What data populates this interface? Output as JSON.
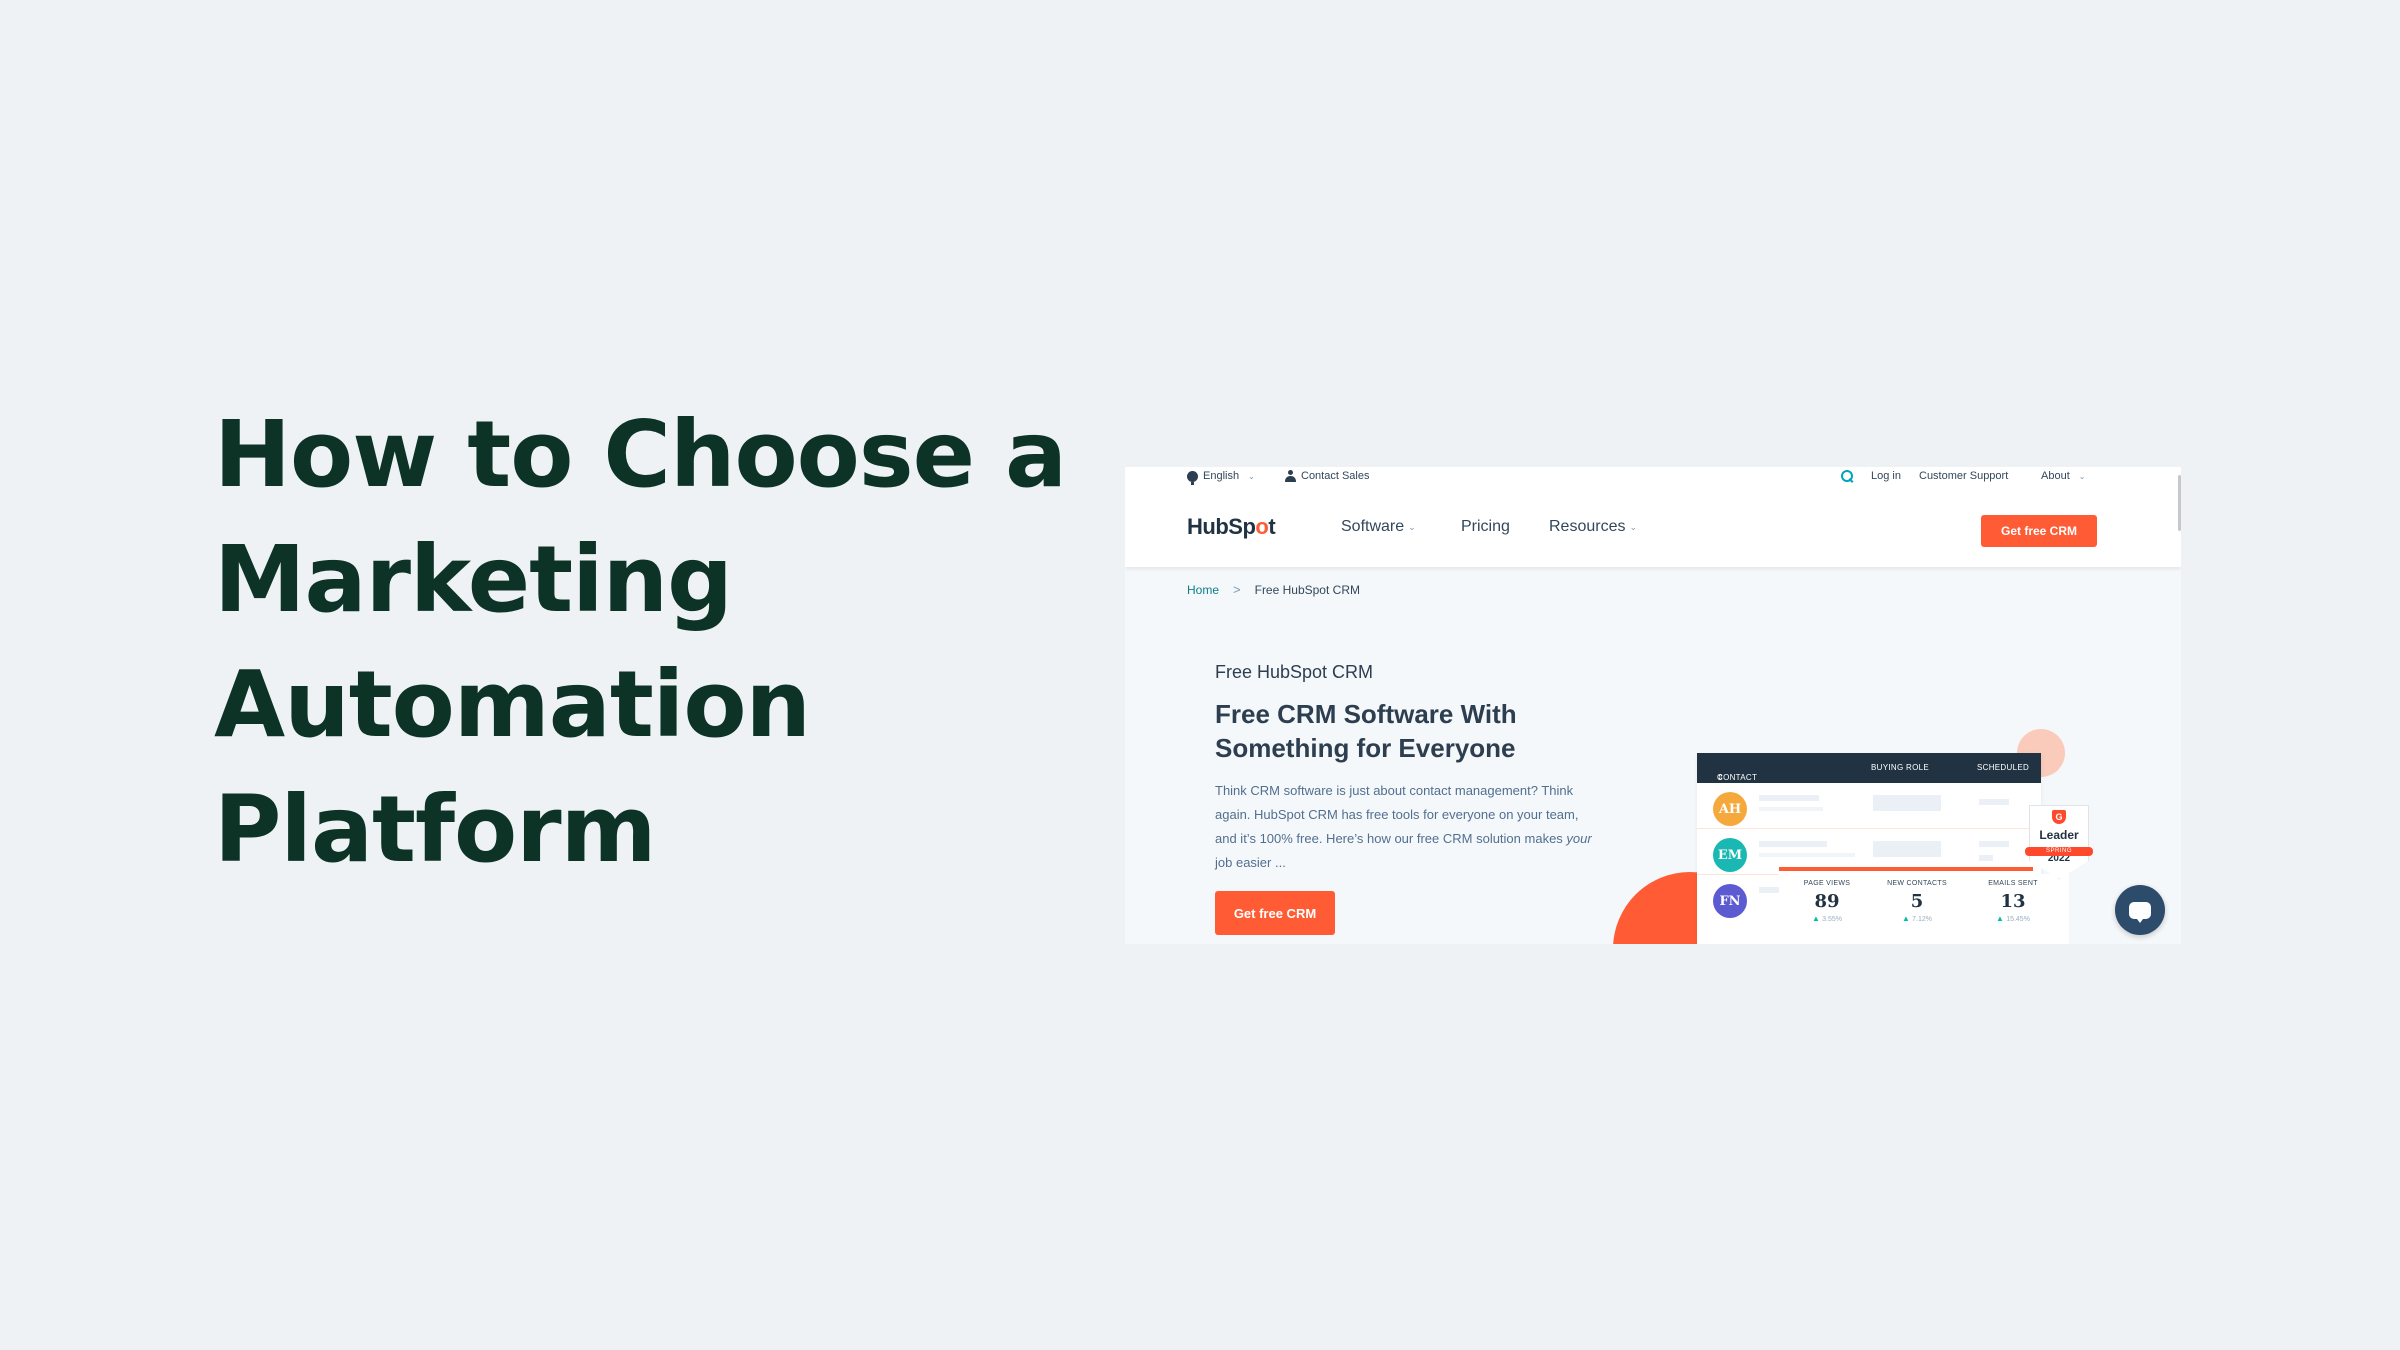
{
  "headline": {
    "lines": [
      "How to Choose a",
      "Marketing",
      "Automation",
      "Platform"
    ]
  },
  "screenshot": {
    "utility_nav": {
      "language": "English",
      "contact_sales": "Contact Sales",
      "login": "Log in",
      "customer_support": "Customer Support",
      "about": "About"
    },
    "logo": {
      "text_pre": "HubSp",
      "text_o": "o",
      "text_post": "t"
    },
    "main_nav": {
      "software": "Software",
      "pricing": "Pricing",
      "resources": "Resources",
      "cta": "Get free CRM"
    },
    "breadcrumb": {
      "home": "Home",
      "separator": ">",
      "current": "Free HubSpot CRM"
    },
    "hero": {
      "eyebrow": "Free HubSpot CRM",
      "title": "Free CRM Software With Something for Everyone",
      "body_pre": "Think CRM software is just about contact management? Think again. HubSpot CRM has free tools for everyone on your team, and it’s 100% free. Here’s how our free CRM solution makes ",
      "body_em": "your",
      "body_post": " job easier ...",
      "cta": "Get free CRM"
    },
    "illustration": {
      "table_headers": [
        "CONTACT",
        "BUYING ROLE",
        "SCHEDULED"
      ],
      "contacts": [
        {
          "initials": "AH",
          "color": "#f5a93d"
        },
        {
          "initials": "EM",
          "color": "#1ab8b2"
        },
        {
          "initials": "FN",
          "color": "#5c5bd1"
        }
      ],
      "stats": [
        {
          "label": "PAGE VIEWS",
          "value": "89",
          "change": "3.55%"
        },
        {
          "label": "NEW CONTACTS",
          "value": "5",
          "change": "7.12%"
        },
        {
          "label": "EMAILS SENT",
          "value": "13",
          "change": "15.45%"
        }
      ],
      "badge": {
        "brand": "G",
        "title": "Leader",
        "season": "SPRING",
        "year": "2022"
      }
    }
  },
  "colors": {
    "page_bg": "#eff2f5",
    "headline": "#0c3326",
    "accent_orange": "#ff5c35",
    "teal": "#00a4bd",
    "navy": "#213343"
  }
}
